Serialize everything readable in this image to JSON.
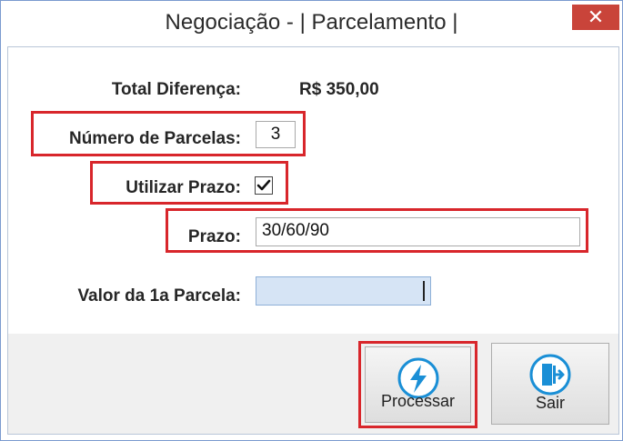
{
  "window": {
    "title": "Negociação - | Parcelamento |",
    "close_symbol": "✕"
  },
  "form": {
    "total_label": "Total Diferença:",
    "total_value": "R$ 350,00",
    "parcelas_label": "Número de Parcelas:",
    "parcelas_value": "3",
    "utilizar_prazo_label": "Utilizar Prazo:",
    "utilizar_prazo_checked": true,
    "prazo_label": "Prazo:",
    "prazo_value": "30/60/90",
    "valor_1a_label": "Valor da 1a Parcela:",
    "valor_1a_value": ""
  },
  "buttons": {
    "processar_label": "Processar",
    "sair_label": "Sair"
  },
  "colors": {
    "highlight": "#d8262b",
    "icon_blue": "#1a8fd6",
    "close_red": "#c9443a"
  }
}
